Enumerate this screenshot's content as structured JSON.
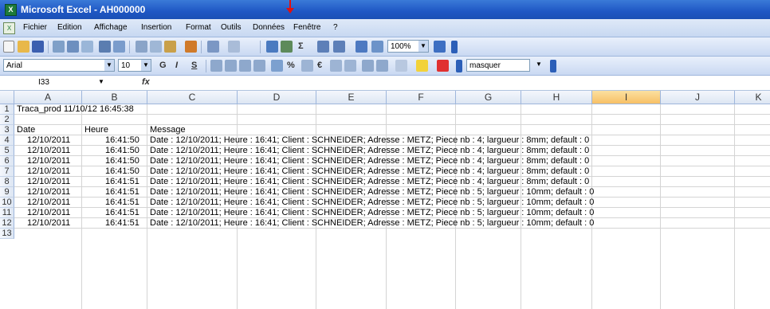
{
  "window": {
    "title": "Microsoft Excel - AH000000",
    "app_icon_glyph": "X"
  },
  "menu": [
    "Fichier",
    "Edition",
    "Affichage",
    "Insertion",
    "Format",
    "Outils",
    "Données",
    "Fenêtre",
    "?"
  ],
  "format_toolbar": {
    "font_name": "Arial",
    "font_size": "10",
    "zoom": "100%",
    "bold_glyph": "G",
    "italic_glyph": "I",
    "underline_glyph": "S",
    "percent_glyph": "%",
    "euro_glyph": "€",
    "style_combo": "masquer"
  },
  "formula_bar": {
    "name_box": "I33",
    "fx_label": "fx"
  },
  "grid": {
    "columns": [
      "A",
      "B",
      "C",
      "D",
      "E",
      "F",
      "G",
      "H",
      "I",
      "J",
      "K"
    ],
    "selected_column": "I",
    "row_numbers": [
      "1",
      "2",
      "3",
      "4",
      "5",
      "6",
      "7",
      "8",
      "9",
      "10",
      "11",
      "12",
      "13"
    ],
    "row1": "Traca_prod 11/10/12 16:45:38",
    "headers": {
      "date": "Date",
      "heure": "Heure",
      "message": "Message"
    },
    "rows": [
      {
        "date": "12/10/2011",
        "time": "16:41:50",
        "msg": "Date : 12/10/2011; Heure : 16:41; Client : SCHNEIDER; Adresse : METZ; Piece nb : 4; largueur : 8mm; default : 0"
      },
      {
        "date": "12/10/2011",
        "time": "16:41:50",
        "msg": "Date : 12/10/2011; Heure : 16:41; Client : SCHNEIDER; Adresse : METZ; Piece nb : 4; largueur : 8mm; default : 0"
      },
      {
        "date": "12/10/2011",
        "time": "16:41:50",
        "msg": "Date : 12/10/2011; Heure : 16:41; Client : SCHNEIDER; Adresse : METZ; Piece nb : 4; largueur : 8mm; default : 0"
      },
      {
        "date": "12/10/2011",
        "time": "16:41:50",
        "msg": "Date : 12/10/2011; Heure : 16:41; Client : SCHNEIDER; Adresse : METZ; Piece nb : 4; largueur : 8mm; default : 0"
      },
      {
        "date": "12/10/2011",
        "time": "16:41:51",
        "msg": "Date : 12/10/2011; Heure : 16:41; Client : SCHNEIDER; Adresse : METZ; Piece nb : 4; largueur : 8mm; default : 0"
      },
      {
        "date": "12/10/2011",
        "time": "16:41:51",
        "msg": "Date : 12/10/2011; Heure : 16:41; Client : SCHNEIDER; Adresse : METZ; Piece nb : 5; largueur : 10mm; default : 0"
      },
      {
        "date": "12/10/2011",
        "time": "16:41:51",
        "msg": "Date : 12/10/2011; Heure : 16:41; Client : SCHNEIDER; Adresse : METZ; Piece nb : 5; largueur : 10mm; default : 0"
      },
      {
        "date": "12/10/2011",
        "time": "16:41:51",
        "msg": "Date : 12/10/2011; Heure : 16:41; Client : SCHNEIDER; Adresse : METZ; Piece nb : 5; largueur : 10mm; default : 0"
      },
      {
        "date": "12/10/2011",
        "time": "16:41:51",
        "msg": "Date : 12/10/2011; Heure : 16:41; Client : SCHNEIDER; Adresse : METZ; Piece nb : 5; largueur : 10mm; default : 0"
      }
    ]
  },
  "colors": {
    "title_bar": "#1f57c4",
    "selected_column_header": "#f7c066",
    "annotation_arrow": "#e01010"
  }
}
